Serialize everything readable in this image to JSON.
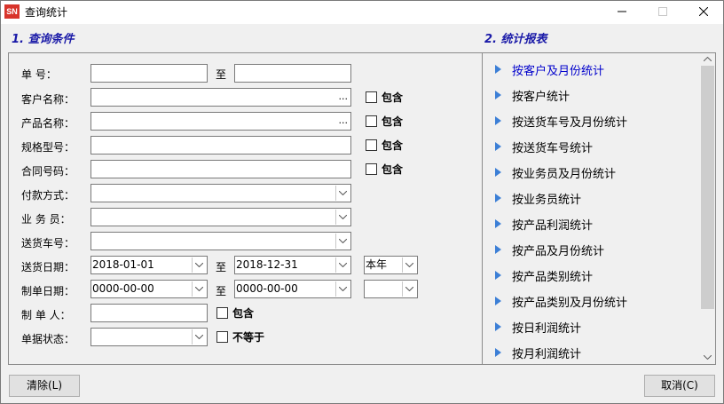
{
  "window": {
    "title": "查询统计",
    "icon_text": "SN"
  },
  "sections": {
    "query_title": "1. 查询条件",
    "report_title": "2. 统计报表"
  },
  "form": {
    "order_no_label": "单 号：",
    "order_no_to": "至",
    "customer_label": "客户名称：",
    "product_label": "产品名称：",
    "spec_label": "规格型号：",
    "contract_label": "合同号码：",
    "payment_label": "付款方式：",
    "salesman_label": "业 务 员：",
    "truck_label": "送货车号：",
    "delivery_date_label": "送货日期：",
    "delivery_date_from": "2018-01-01",
    "delivery_date_to_label": "至",
    "delivery_date_to": "2018-12-31",
    "delivery_period": "本年",
    "create_date_label": "制单日期：",
    "create_date_from": "0000-00-00",
    "create_date_to_label": "至",
    "create_date_to": "0000-00-00",
    "creator_label": "制 单 人：",
    "status_label": "单据状态：",
    "contains": "包含",
    "not_equal": "不等于",
    "ellipsis": "..."
  },
  "reports": [
    "按客户及月份统计",
    "按客户统计",
    "按送货车号及月份统计",
    "按送货车号统计",
    "按业务员及月份统计",
    "按业务员统计",
    "按产品利润统计",
    "按产品及月份统计",
    "按产品类别统计",
    "按产品类别及月份统计",
    "按日利润统计",
    "按月利润统计"
  ],
  "buttons": {
    "clear": "清除(L)",
    "cancel": "取消(C)"
  },
  "colors": {
    "accent": "#1a1aa8",
    "selected_text": "#0000cc",
    "triangle": "#3c7fd6"
  }
}
